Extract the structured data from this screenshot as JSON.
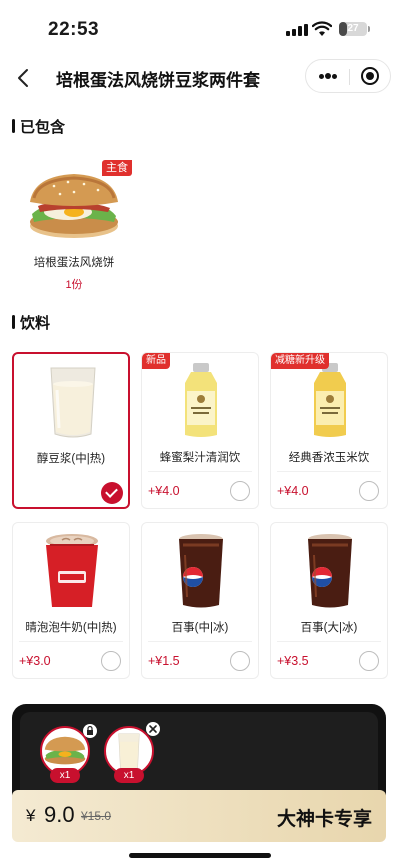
{
  "status_bar": {
    "time": "22:53",
    "battery": "27",
    "battery_level": 0.27
  },
  "nav": {
    "title": "培根蛋法风烧饼豆浆两件套",
    "back_icon": "chevron-left-icon",
    "more_icon": "more-dots-icon",
    "close_icon": "target-close-icon"
  },
  "included": {
    "heading": "已包含",
    "items": [
      {
        "tag": "主食",
        "name": "培根蛋法风烧饼",
        "qty": "1份"
      }
    ]
  },
  "drinks": {
    "heading": "饮料",
    "items": [
      {
        "name": "醇豆浆(中|热)",
        "price": "",
        "tag": "",
        "selected": true
      },
      {
        "name": "蜂蜜梨汁清润饮",
        "price": "+¥4.0",
        "tag": "新品",
        "selected": false
      },
      {
        "name": "经典香浓玉米饮",
        "price": "+¥4.0",
        "tag": "减糖新升级",
        "selected": false
      },
      {
        "name": "晴泡泡牛奶(中|热)",
        "price": "+¥3.0",
        "tag": "",
        "selected": false
      },
      {
        "name": "百事(中|冰)",
        "price": "+¥1.5",
        "tag": "",
        "selected": false
      },
      {
        "name": "百事(大|冰)",
        "price": "+¥3.5",
        "tag": "",
        "selected": false
      }
    ]
  },
  "tray": {
    "items": [
      {
        "count": "x1",
        "locked": true
      },
      {
        "count": "x1",
        "locked": false
      }
    ]
  },
  "checkout": {
    "currency": "¥",
    "price": "9.0",
    "original_price": "¥15.0",
    "promo_label": "大神卡专享"
  },
  "colors": {
    "accent": "#c8102e",
    "tag_red": "#e0302d",
    "gold_start": "#f4ead2",
    "gold_end": "#e8d6ad"
  }
}
